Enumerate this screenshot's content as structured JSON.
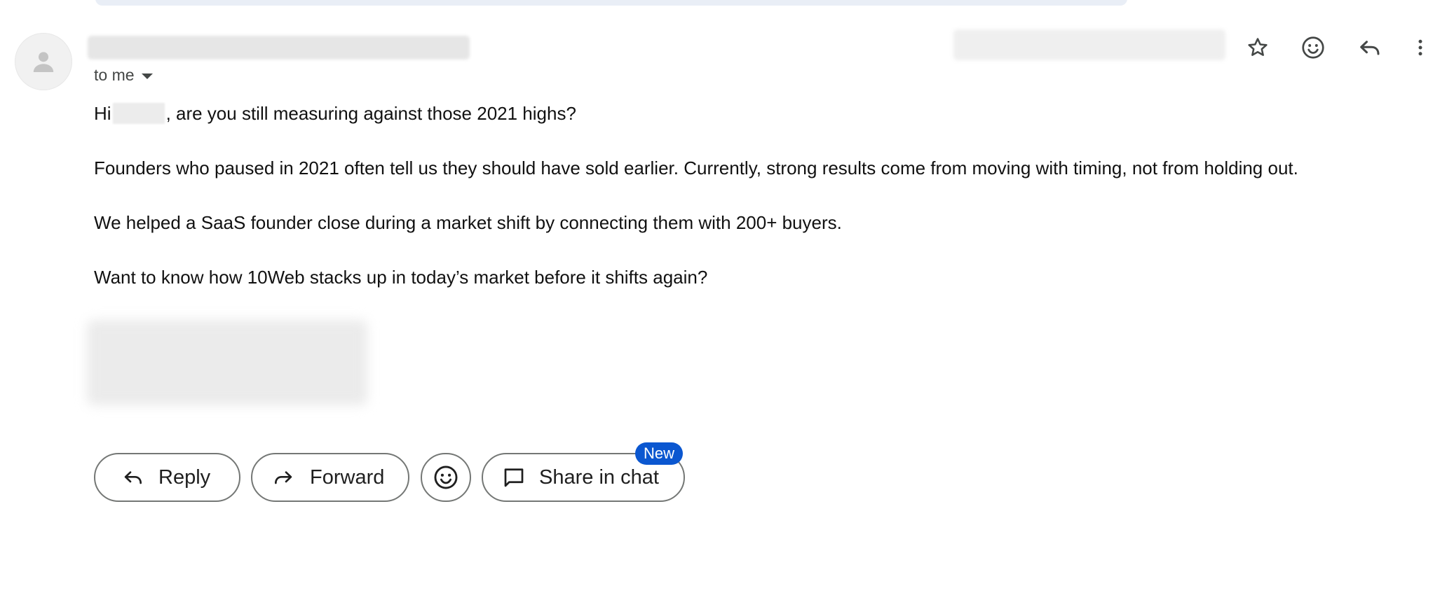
{
  "header": {
    "recipient_label": "to me"
  },
  "message": {
    "greeting_prefix": "Hi",
    "greeting_suffix": ", are you still measuring against those 2021 highs?",
    "paragraph_2": "Founders who paused in 2021 often tell us they should have sold earlier. Currently, strong results come from moving with timing, not from holding out.",
    "paragraph_3": "We helped a SaaS founder close during a market shift by connecting them with 200+ buyers.",
    "paragraph_4": "Want to know how 10Web stacks up in today’s market before it shifts again?"
  },
  "actions": {
    "reply_label": "Reply",
    "forward_label": "Forward",
    "share_label": "Share in chat",
    "new_badge": "New"
  },
  "icons": {
    "avatar": "person-icon",
    "star": "star-icon",
    "emoji": "emoji-icon",
    "reply": "reply-icon",
    "more": "more-vert-icon",
    "forward": "forward-icon",
    "chat": "chat-icon"
  },
  "colors": {
    "badge": "#0b57d0",
    "pill_border": "#747775",
    "top_bar": "#e9eef6"
  }
}
